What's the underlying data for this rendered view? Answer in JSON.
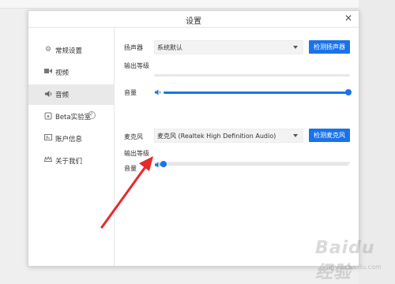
{
  "dialog": {
    "title": "设置"
  },
  "sidebar": {
    "items": [
      {
        "label": "常规设置"
      },
      {
        "label": "视频"
      },
      {
        "label": "音频"
      },
      {
        "label": "Beta实验室"
      },
      {
        "label": "账户信息"
      },
      {
        "label": "关于我们"
      }
    ]
  },
  "speaker": {
    "label": "扬声器",
    "device": "系统默认",
    "test_button": "检测扬声器",
    "output_level_label": "输出等级",
    "volume_label": "音量",
    "volume_fraction": 1.0
  },
  "microphone": {
    "label": "麦克风",
    "device": "麦克风 (Realtek High Definition Audio)",
    "test_button": "检测麦克风",
    "output_level_label": "输出等级",
    "volume_label": "音量",
    "volume_fraction": 0.0
  },
  "watermark": {
    "text": "Baidu经验",
    "url": "jingyan.baidu.com"
  },
  "colors": {
    "accent": "#1a73e8",
    "arrow": "#e8292b"
  }
}
